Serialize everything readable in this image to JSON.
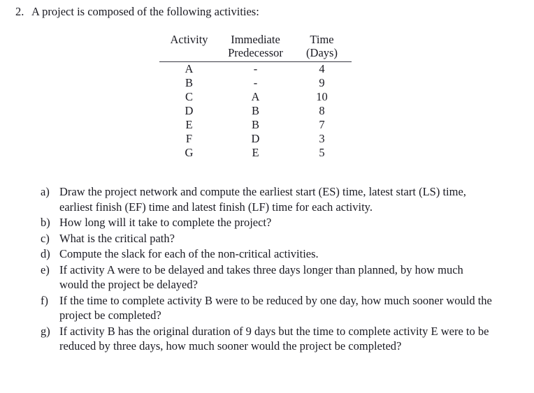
{
  "question": {
    "number": "2.",
    "stem": "A project is composed of the following activities:"
  },
  "table": {
    "headers": {
      "activity": "Activity",
      "predecessor_line1": "Immediate",
      "predecessor_line2": "Predecessor",
      "time_line1": "Time",
      "time_line2": "(Days)"
    },
    "rows": [
      {
        "activity": "A",
        "predecessor": "-",
        "time": "4"
      },
      {
        "activity": "B",
        "predecessor": "-",
        "time": "9"
      },
      {
        "activity": "C",
        "predecessor": "A",
        "time": "10"
      },
      {
        "activity": "D",
        "predecessor": "B",
        "time": "8"
      },
      {
        "activity": "E",
        "predecessor": "B",
        "time": "7"
      },
      {
        "activity": "F",
        "predecessor": "D",
        "time": "3"
      },
      {
        "activity": "G",
        "predecessor": "E",
        "time": "5"
      }
    ]
  },
  "subquestions": [
    {
      "marker": "a)",
      "text": "Draw the project network and compute the earliest start (ES) time, latest start (LS) time, earliest finish (EF) time and latest finish (LF) time for each activity."
    },
    {
      "marker": "b)",
      "text": "How long will it take to complete the project?"
    },
    {
      "marker": "c)",
      "text": "What is the critical path?"
    },
    {
      "marker": "d)",
      "text": "Compute the slack for each of the non-critical activities."
    },
    {
      "marker": "e)",
      "text": "If activity A were to be delayed and takes three days longer than planned, by how much would the project be delayed?"
    },
    {
      "marker": "f)",
      "text": "If the time to complete activity B were to be reduced by one day, how much sooner would the project be completed?"
    },
    {
      "marker": "g)",
      "text": "If activity B has the original duration of 9 days but the time to complete activity E were to be reduced by three days, how much sooner would the project be completed?"
    }
  ]
}
